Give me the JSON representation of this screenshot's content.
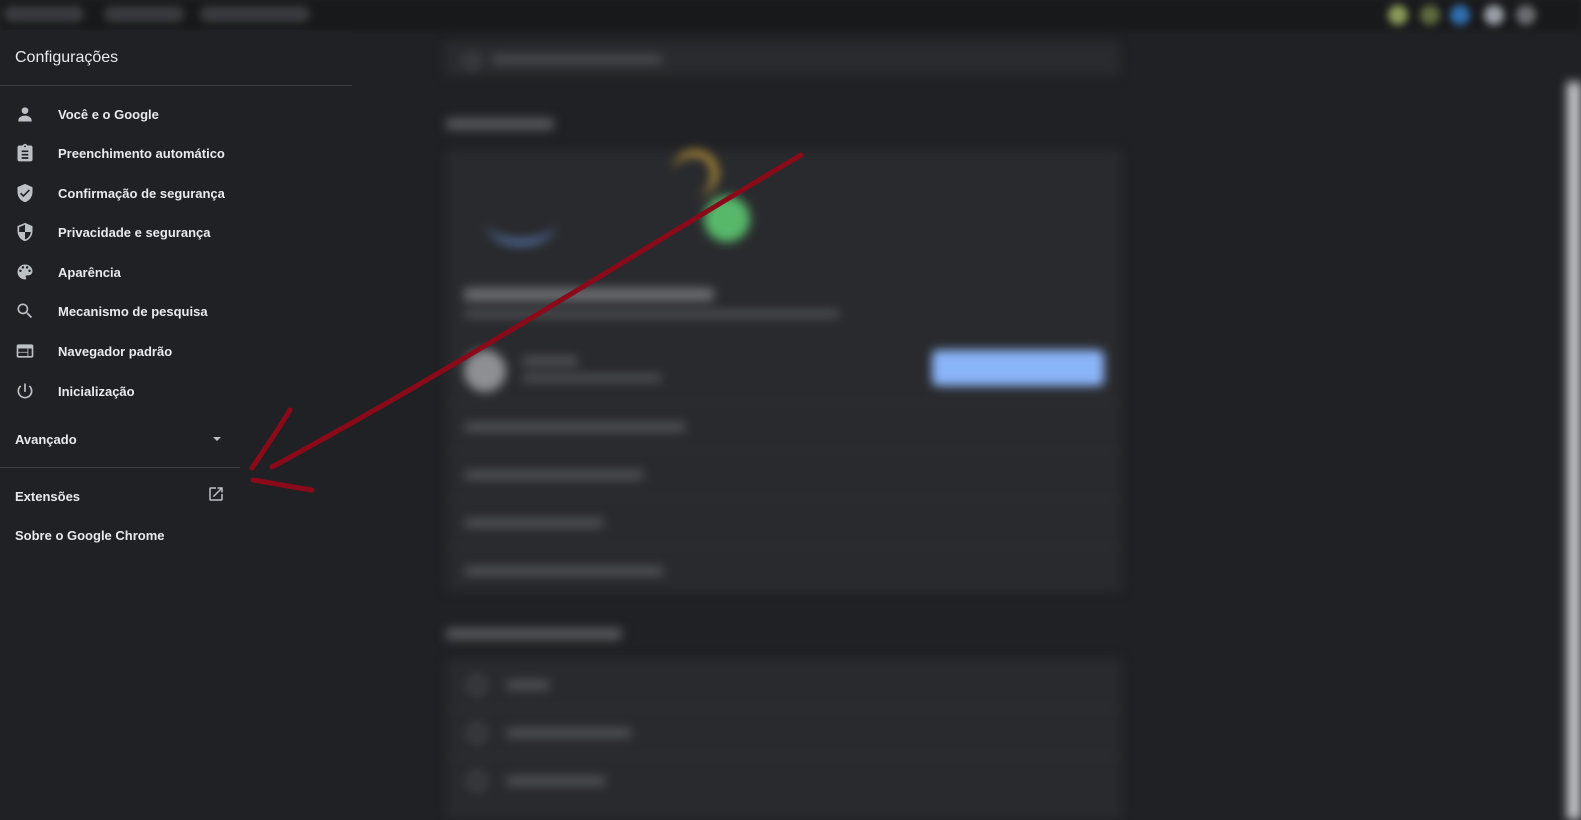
{
  "sidebar": {
    "title": "Configurações",
    "items": [
      {
        "label": "Você e o Google",
        "icon": "person-icon"
      },
      {
        "label": "Preenchimento automático",
        "icon": "clipboard-icon"
      },
      {
        "label": "Confirmação de segurança",
        "icon": "shield-check-icon"
      },
      {
        "label": "Privacidade e segurança",
        "icon": "shield-icon"
      },
      {
        "label": "Aparência",
        "icon": "palette-icon"
      },
      {
        "label": "Mecanismo de pesquisa",
        "icon": "search-icon"
      },
      {
        "label": "Navegador padrão",
        "icon": "browser-window-icon"
      },
      {
        "label": "Inicialização",
        "icon": "power-icon"
      }
    ],
    "advanced_label": "Avançado",
    "extensions_label": "Extensões",
    "about_label": "Sobre o Google Chrome"
  },
  "colors": {
    "background": "#202124",
    "text": "#e8eaed",
    "icon": "#bdc1c6",
    "annotation_arrow": "#8b0a1a",
    "accent_button": "#8ab4f8"
  }
}
